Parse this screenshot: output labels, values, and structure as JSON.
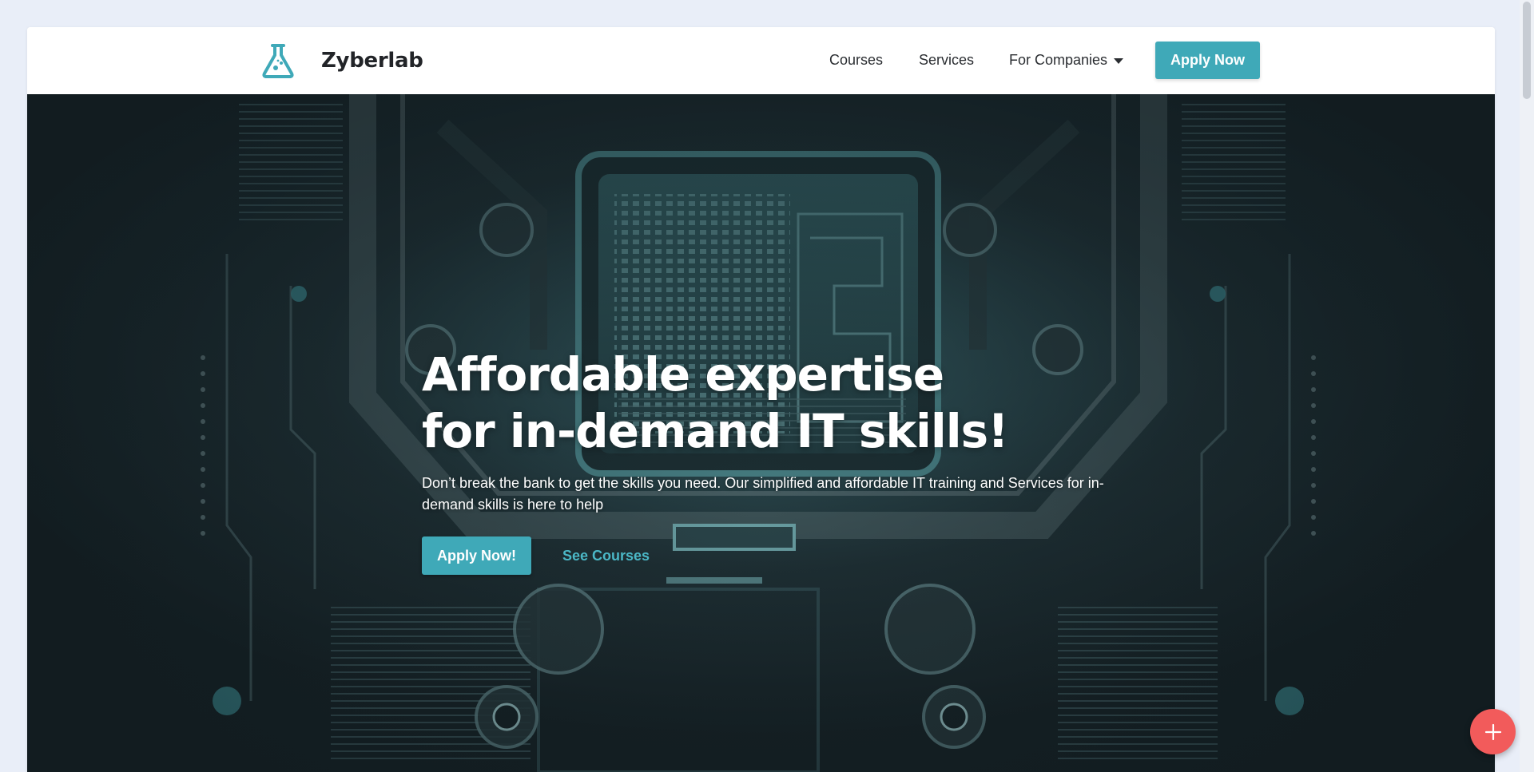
{
  "brand": {
    "name": "Zyberlab",
    "icon": "flask-icon"
  },
  "nav": {
    "courses": "Courses",
    "services": "Services",
    "companies": "For Companies",
    "apply": "Apply Now"
  },
  "hero": {
    "title_line1": "Affordable expertise",
    "title_line2": "for in-demand IT skills!",
    "subtitle": "Don’t break the bank to get the skills you need. Our simplified and affordable IT training and Services for in-demand skills is here to help",
    "apply_button": "Apply Now!",
    "courses_link": "See Courses",
    "background": "circuit-board-illustration"
  },
  "fab": {
    "icon": "plus-icon"
  },
  "colors": {
    "accent": "#3fa9b8",
    "accent_link": "#4bb7c6",
    "fab": "#f25b5b",
    "hero_bg": "#1d292e",
    "page_bg": "#e9eef8"
  }
}
